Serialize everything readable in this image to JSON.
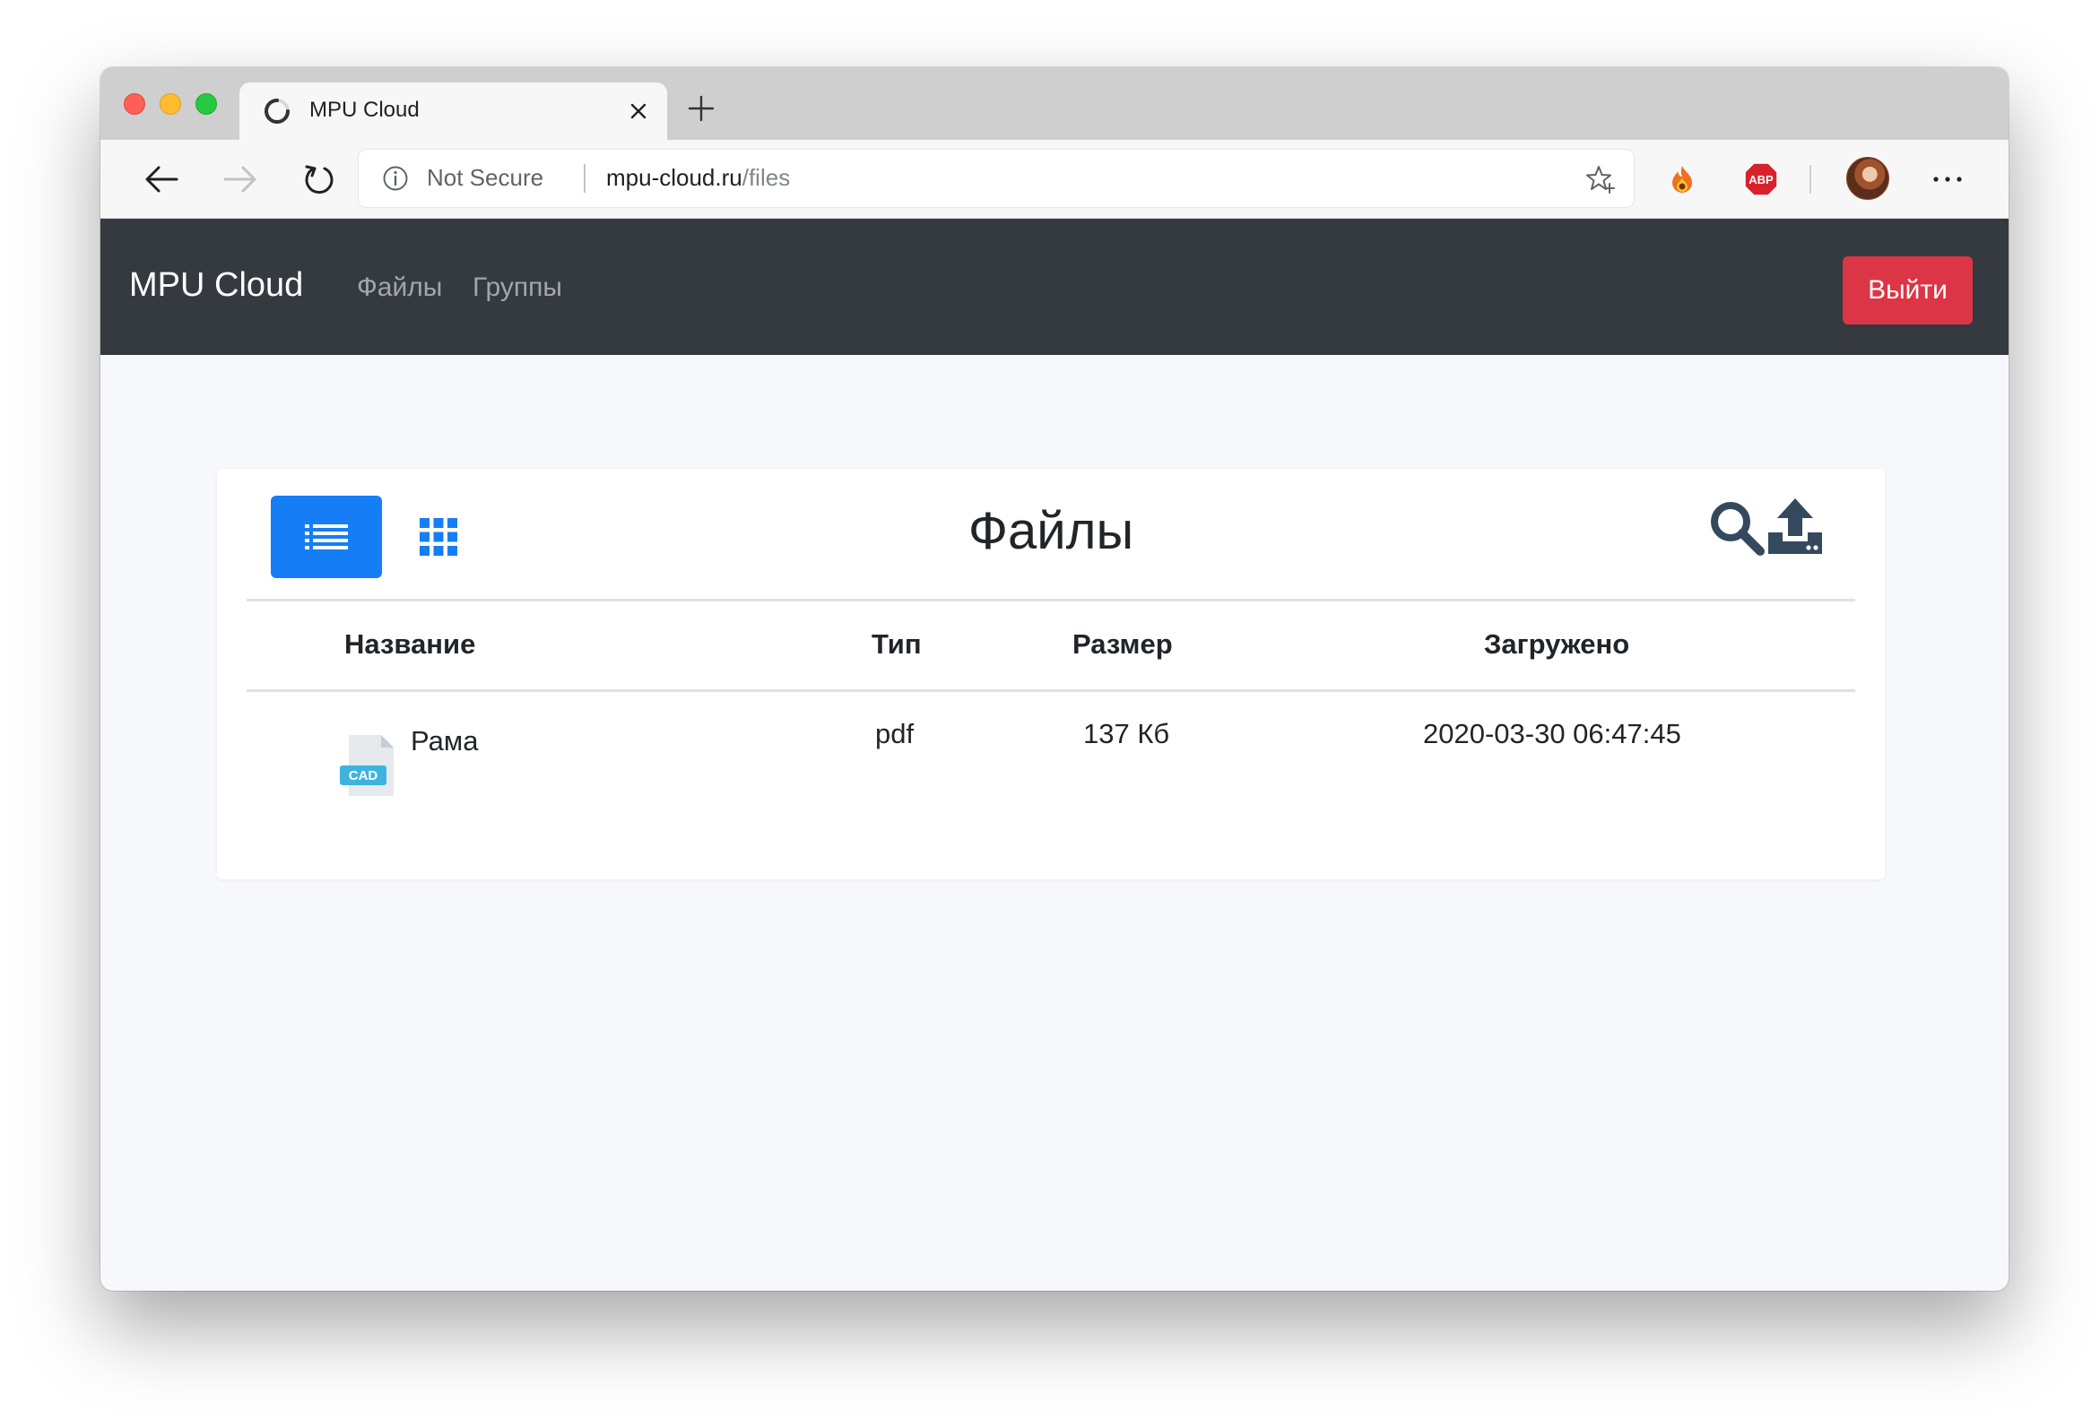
{
  "browser": {
    "tab_title": "MPU Cloud",
    "security_label": "Not Secure",
    "url_host": "mpu-cloud.ru",
    "url_path": "/files",
    "extensions": [
      "fire-extension-icon",
      "adblock-plus-icon"
    ],
    "adblock_label": "ABP"
  },
  "navbar": {
    "brand": "MPU Cloud",
    "links": [
      {
        "label": "Файлы"
      },
      {
        "label": "Группы"
      }
    ],
    "logout_label": "Выйти",
    "logout_color": "#dc3545",
    "background": "#343a40"
  },
  "files": {
    "title": "Файлы",
    "view_mode": "list",
    "accent_color": "#157ef6",
    "columns": [
      "Название",
      "Тип",
      "Размер",
      "Загружено"
    ],
    "rows": [
      {
        "icon": "cad-file-icon",
        "icon_label": "CAD",
        "name": "Рама",
        "type": "pdf",
        "size": "137 Кб",
        "uploaded": "2020-03-30 06:47:45"
      }
    ]
  }
}
